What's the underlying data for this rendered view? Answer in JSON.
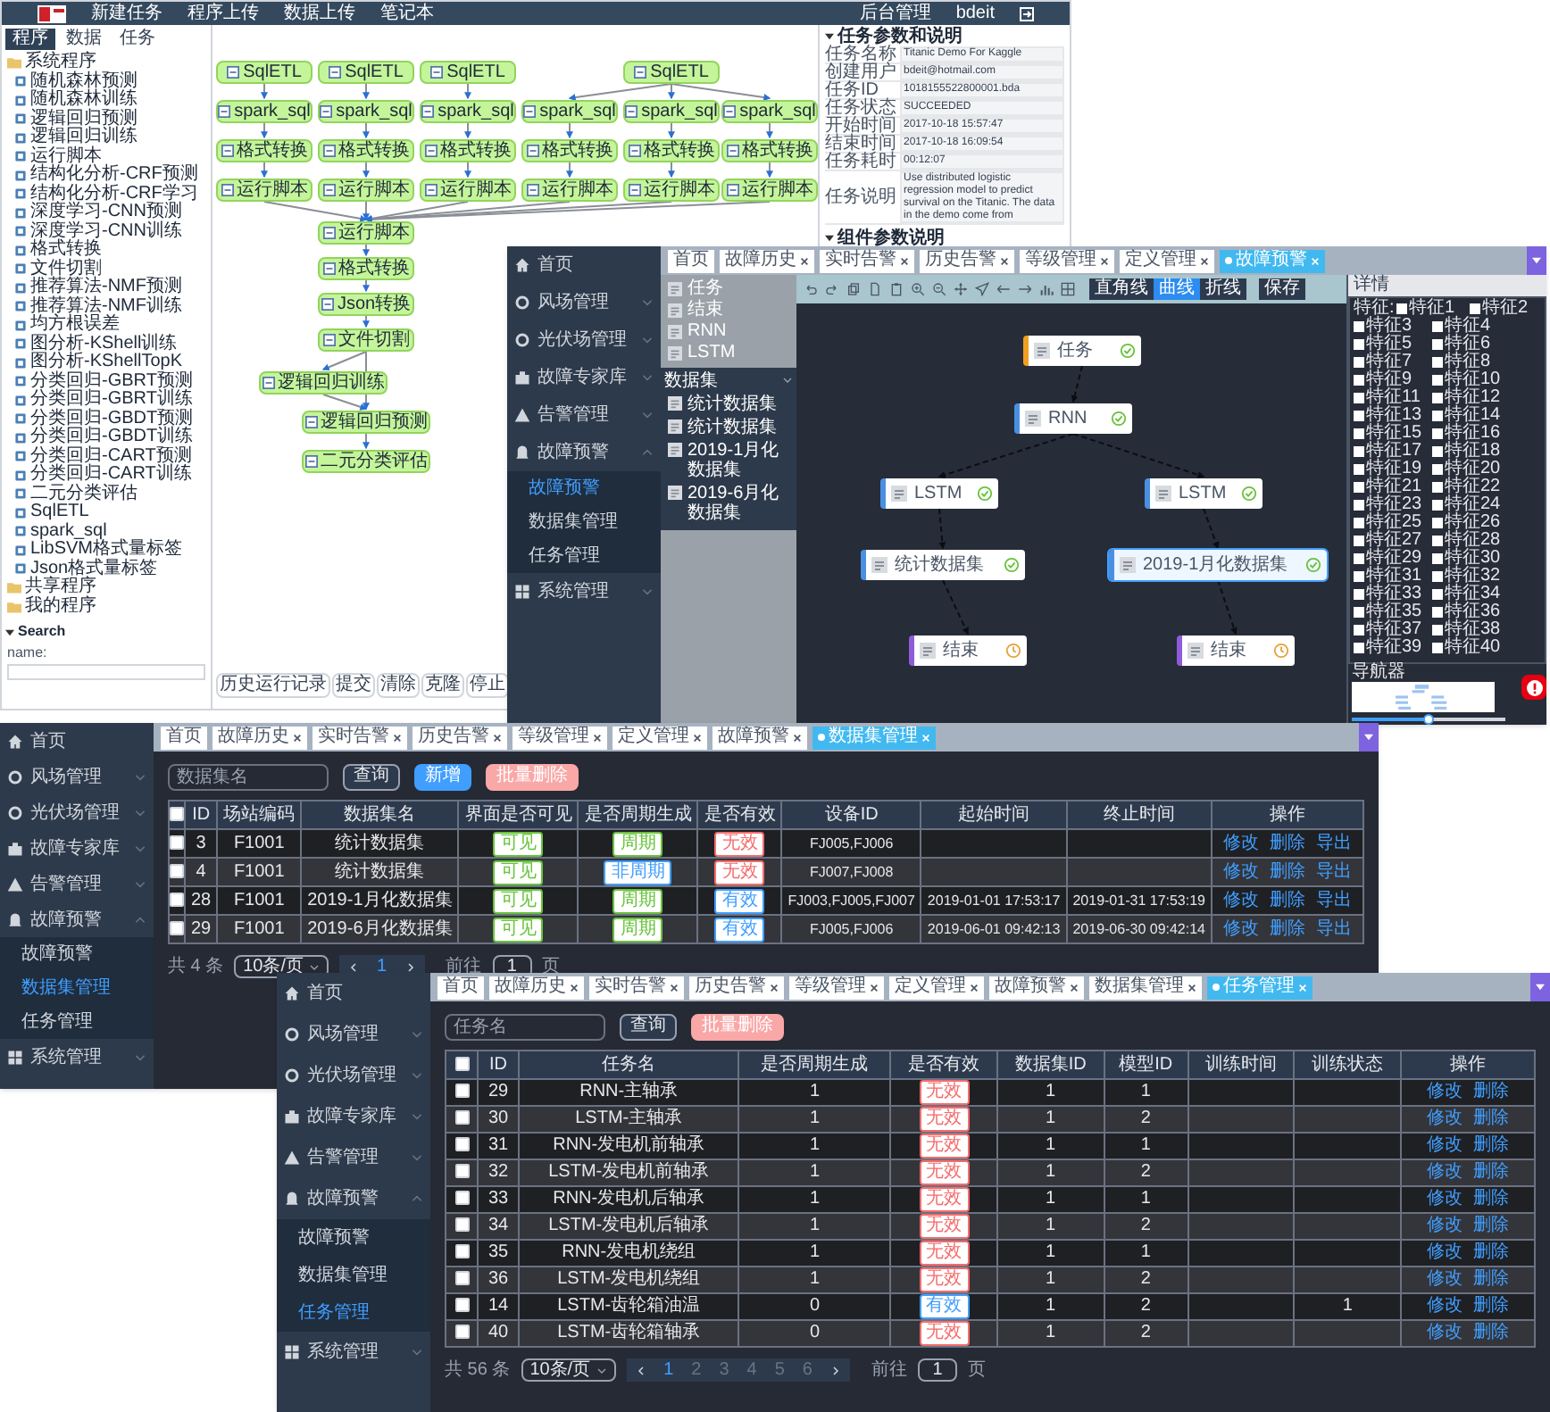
{
  "workflow_app": {
    "nav": [
      "新建任务",
      "程序上传",
      "数据上传",
      "笔记本"
    ],
    "user_links": [
      "后台管理",
      "bdeit"
    ],
    "sidebar_tabs": [
      {
        "label": "程序",
        "selected": true
      },
      {
        "label": "数据",
        "selected": false
      },
      {
        "label": "任务",
        "selected": false
      }
    ],
    "tree": [
      {
        "label": "系统程序",
        "children": [
          "随机森林预测",
          "随机森林训练",
          "逻辑回归预测",
          "逻辑回归训练",
          "运行脚本",
          "结构化分析-CRF预测",
          "结构化分析-CRF学习",
          "深度学习-CNN预测",
          "深度学习-CNN训练",
          "格式转换",
          "文件切割",
          "推荐算法-NMF预测",
          "推荐算法-NMF训练",
          "均方根误差",
          "图分析-KShell训练",
          "图分析-KShellTopK",
          "分类回归-GBRT预测",
          "分类回归-GBRT训练",
          "分类回归-GBDT预测",
          "分类回归-GBDT训练",
          "分类回归-CART预测",
          "分类回归-CART训练",
          "二元分类评估",
          "SqlETL",
          "spark_sql",
          "LibSVM格式量标签",
          "Json格式量标签"
        ]
      },
      {
        "label": "共享程序"
      },
      {
        "label": "我的程序"
      }
    ],
    "search": {
      "title": "Search",
      "field_label": "name:"
    },
    "graph_nodes": [
      "SqlETL",
      "SqlETL",
      "SqlETL",
      "SqlETL",
      "spark_sql",
      "spark_sql",
      "spark_sql",
      "spark_sql",
      "spark_sql",
      "spark_sql",
      "格式转换",
      "格式转换",
      "格式转换",
      "格式转换",
      "格式转换",
      "格式转换",
      "运行脚本",
      "运行脚本",
      "运行脚本",
      "运行脚本",
      "运行脚本",
      "运行脚本",
      "运行脚本",
      "格式转换",
      "Json转换",
      "文件切割",
      "逻辑回归训练",
      "逻辑回归预测",
      "二元分类评估"
    ],
    "buttons": [
      "历史运行记录",
      "提交",
      "清除",
      "克隆",
      "停止"
    ],
    "task_params": {
      "title": "任务参数和说明",
      "rows": [
        {
          "label": "任务名称",
          "value": "Titanic Demo For Kaggle"
        },
        {
          "label": "创建用户",
          "value": "bdeit@hotmail.com"
        },
        {
          "label": "任务ID",
          "value": "1018155522800001.bda"
        },
        {
          "label": "任务状态",
          "value": "SUCCEEDED"
        },
        {
          "label": "开始时间",
          "value": "2017-10-18 15:57:47"
        },
        {
          "label": "结束时间",
          "value": "2017-10-18 16:09:54"
        },
        {
          "label": "任务耗时",
          "value": "00:12:07"
        },
        {
          "label": "任务说明",
          "value": "Use distributed logistic regression model to predict survival on the Titanic. The data in the demo come from"
        }
      ]
    },
    "component_params": {
      "title": "组件参数说明"
    }
  },
  "fault_flow_app": {
    "menu": [
      {
        "label": "首页"
      },
      {
        "label": "风场管理",
        "expanded": false
      },
      {
        "label": "光伏场管理",
        "expanded": false
      },
      {
        "label": "故障专家库",
        "expanded": false
      },
      {
        "label": "告警管理",
        "expanded": false
      },
      {
        "label": "故障预警",
        "expanded": true,
        "children": [
          {
            "label": "故障预警",
            "selected": true
          },
          {
            "label": "数据集管理",
            "selected": false
          },
          {
            "label": "任务管理",
            "selected": false
          }
        ]
      },
      {
        "label": "系统管理",
        "expanded": false
      }
    ],
    "tabs": [
      {
        "label": "首页",
        "closable": false,
        "selected": false
      },
      {
        "label": "故障历史",
        "closable": true,
        "selected": false
      },
      {
        "label": "实时告警",
        "closable": true,
        "selected": false
      },
      {
        "label": "历史告警",
        "closable": true,
        "selected": false
      },
      {
        "label": "等级管理",
        "closable": true,
        "selected": false
      },
      {
        "label": "定义管理",
        "closable": true,
        "selected": false
      },
      {
        "label": "故障预警",
        "closable": true,
        "selected": true
      }
    ],
    "palette": {
      "nodes": [
        "任务",
        "结束",
        "RNN",
        "LSTM"
      ],
      "dataset_title": "数据集",
      "datasets": [
        "统计数据集",
        "统计数据集",
        "2019-1月化数据集",
        "2019-6月化数据集"
      ]
    },
    "line_styles": [
      {
        "label": "直角线",
        "selected": false
      },
      {
        "label": "曲线",
        "selected": true
      },
      {
        "label": "折线",
        "selected": false
      }
    ],
    "save_button": "保存",
    "flow_nodes": [
      {
        "label": "任务",
        "color": "#f0a020",
        "done": true,
        "selected": false
      },
      {
        "label": "RNN",
        "color": "#4a90e2",
        "done": true,
        "selected": false
      },
      {
        "label": "LSTM",
        "color": "#4a90e2",
        "done": true,
        "selected": false
      },
      {
        "label": "LSTM",
        "color": "#4a90e2",
        "done": true,
        "selected": false
      },
      {
        "label": "统计数据集",
        "color": "#4a90e2",
        "done": true,
        "selected": false
      },
      {
        "label": "2019-1月化数据集",
        "color": "#4a90e2",
        "done": true,
        "selected": true
      },
      {
        "label": "结束",
        "color": "#8e5cd9",
        "done": false,
        "selected": false
      },
      {
        "label": "结束",
        "color": "#8e5cd9",
        "done": false,
        "selected": false
      }
    ],
    "details": {
      "title": "详情",
      "feature_label": "特征:",
      "features": [
        {
          "label": "特征1",
          "checked": false
        },
        {
          "label": "特征2",
          "checked": false
        },
        {
          "label": "特征3",
          "checked": false
        },
        {
          "label": "特征4",
          "checked": false
        },
        {
          "label": "特征5",
          "checked": false
        },
        {
          "label": "特征6",
          "checked": false
        },
        {
          "label": "特征7",
          "checked": false
        },
        {
          "label": "特征8",
          "checked": false
        },
        {
          "label": "特征9",
          "checked": false
        },
        {
          "label": "特征10",
          "checked": false
        },
        {
          "label": "特征11",
          "checked": false
        },
        {
          "label": "特征12",
          "checked": false
        },
        {
          "label": "特征13",
          "checked": false
        },
        {
          "label": "特征14",
          "checked": false
        },
        {
          "label": "特征15",
          "checked": false
        },
        {
          "label": "特征16",
          "checked": false
        },
        {
          "label": "特征17",
          "checked": false
        },
        {
          "label": "特征18",
          "checked": false
        },
        {
          "label": "特征19",
          "checked": false
        },
        {
          "label": "特征20",
          "checked": false
        },
        {
          "label": "特征21",
          "checked": false
        },
        {
          "label": "特征22",
          "checked": false
        },
        {
          "label": "特征23",
          "checked": false
        },
        {
          "label": "特征24",
          "checked": false
        },
        {
          "label": "特征25",
          "checked": false
        },
        {
          "label": "特征26",
          "checked": false
        },
        {
          "label": "特征27",
          "checked": false
        },
        {
          "label": "特征28",
          "checked": false
        },
        {
          "label": "特征29",
          "checked": false
        },
        {
          "label": "特征30",
          "checked": false
        },
        {
          "label": "特征31",
          "checked": false
        },
        {
          "label": "特征32",
          "checked": false
        },
        {
          "label": "特征33",
          "checked": false
        },
        {
          "label": "特征34",
          "checked": false
        },
        {
          "label": "特征35",
          "checked": false
        },
        {
          "label": "特征36",
          "checked": false
        },
        {
          "label": "特征37",
          "checked": false
        },
        {
          "label": "特征38",
          "checked": false
        },
        {
          "label": "特征39",
          "checked": false
        },
        {
          "label": "特征40",
          "checked": false
        }
      ]
    },
    "navigator": {
      "title": "导航器",
      "zoom": {
        "level": 0.5
      }
    }
  },
  "dataset_app": {
    "menu": [
      {
        "label": "首页"
      },
      {
        "label": "风场管理",
        "expanded": false
      },
      {
        "label": "光伏场管理",
        "expanded": false
      },
      {
        "label": "故障专家库",
        "expanded": false
      },
      {
        "label": "告警管理",
        "expanded": false
      },
      {
        "label": "故障预警",
        "expanded": true,
        "children": [
          {
            "label": "故障预警",
            "selected": false
          },
          {
            "label": "数据集管理",
            "selected": true
          },
          {
            "label": "任务管理",
            "selected": false
          }
        ]
      },
      {
        "label": "系统管理",
        "expanded": false
      }
    ],
    "tabs": [
      {
        "label": "首页",
        "closable": false,
        "selected": false
      },
      {
        "label": "故障历史",
        "closable": true,
        "selected": false
      },
      {
        "label": "实时告警",
        "closable": true,
        "selected": false
      },
      {
        "label": "历史告警",
        "closable": true,
        "selected": false
      },
      {
        "label": "等级管理",
        "closable": true,
        "selected": false
      },
      {
        "label": "定义管理",
        "closable": true,
        "selected": false
      },
      {
        "label": "故障预警",
        "closable": true,
        "selected": false
      },
      {
        "label": "数据集管理",
        "closable": true,
        "selected": true
      }
    ],
    "search": {
      "placeholder": "数据集名"
    },
    "buttons": [
      {
        "label": "查询",
        "kind": "outline"
      },
      {
        "label": "新增",
        "kind": "primary"
      },
      {
        "label": "批量删除",
        "kind": "danger"
      }
    ],
    "table": {
      "header_checked": false,
      "columns": [
        "ID",
        "场站编码",
        "数据集名",
        "界面是否可见",
        "是否周期生成",
        "是否有效",
        "设备ID",
        "起始时间",
        "终止时间",
        "操作"
      ],
      "rows": [
        {
          "checked": false,
          "id": "3",
          "station": "F1001",
          "name": "统计数据集",
          "visible": {
            "text": "可见",
            "color": "#67c23a"
          },
          "periodic": {
            "text": "周期",
            "color": "#67c23a"
          },
          "valid": {
            "text": "无效",
            "color": "#f56c6c"
          },
          "devices": "FJ005,FJ006",
          "actions": [
            "修改",
            "删除",
            "导出"
          ]
        },
        {
          "checked": false,
          "id": "4",
          "station": "F1001",
          "name": "统计数据集",
          "visible": {
            "text": "可见",
            "color": "#67c23a"
          },
          "periodic": {
            "text": "非周期",
            "color": "#409eff"
          },
          "valid": {
            "text": "无效",
            "color": "#f56c6c"
          },
          "devices": "FJ007,FJ008",
          "actions": [
            "修改",
            "删除",
            "导出"
          ]
        },
        {
          "checked": false,
          "id": "28",
          "station": "F1001",
          "name": "2019-1月化数据集",
          "visible": {
            "text": "可见",
            "color": "#67c23a"
          },
          "periodic": {
            "text": "周期",
            "color": "#67c23a"
          },
          "valid": {
            "text": "有效",
            "color": "#409eff"
          },
          "devices": "FJ003,FJ005,FJ007",
          "start": "2019-01-01 17:53:17",
          "end": "2019-01-31 17:53:19",
          "actions": [
            "修改",
            "删除",
            "导出"
          ]
        },
        {
          "checked": false,
          "id": "29",
          "station": "F1001",
          "name": "2019-6月化数据集",
          "visible": {
            "text": "可见",
            "color": "#67c23a"
          },
          "periodic": {
            "text": "周期",
            "color": "#67c23a"
          },
          "valid": {
            "text": "有效",
            "color": "#409eff"
          },
          "devices": "FJ005,FJ006",
          "start": "2019-06-01 09:42:13",
          "end": "2019-06-30 09:42:14",
          "actions": [
            "修改",
            "删除",
            "导出"
          ]
        }
      ]
    },
    "pagination": {
      "total": "共 4 条",
      "page_size": "10条/页",
      "pages": [
        {
          "label": "1",
          "selected": true
        }
      ],
      "goto_label": "前往",
      "goto_value": "1",
      "page_suffix": "页"
    }
  },
  "task_app": {
    "menu": [
      {
        "label": "首页"
      },
      {
        "label": "风场管理",
        "expanded": false
      },
      {
        "label": "光伏场管理",
        "expanded": false
      },
      {
        "label": "故障专家库",
        "expanded": false
      },
      {
        "label": "告警管理",
        "expanded": false
      },
      {
        "label": "故障预警",
        "expanded": true,
        "children": [
          {
            "label": "故障预警",
            "selected": false
          },
          {
            "label": "数据集管理",
            "selected": false
          },
          {
            "label": "任务管理",
            "selected": true
          }
        ]
      },
      {
        "label": "系统管理",
        "expanded": false
      }
    ],
    "tabs": [
      {
        "label": "首页",
        "closable": false,
        "selected": false
      },
      {
        "label": "故障历史",
        "closable": true,
        "selected": false
      },
      {
        "label": "实时告警",
        "closable": true,
        "selected": false
      },
      {
        "label": "历史告警",
        "closable": true,
        "selected": false
      },
      {
        "label": "等级管理",
        "closable": true,
        "selected": false
      },
      {
        "label": "定义管理",
        "closable": true,
        "selected": false
      },
      {
        "label": "故障预警",
        "closable": true,
        "selected": false
      },
      {
        "label": "数据集管理",
        "closable": true,
        "selected": false
      },
      {
        "label": "任务管理",
        "closable": true,
        "selected": true
      }
    ],
    "search": {
      "placeholder": "任务名"
    },
    "buttons": [
      {
        "label": "查询",
        "kind": "outline"
      },
      {
        "label": "批量删除",
        "kind": "danger"
      }
    ],
    "table": {
      "header_checked": false,
      "columns": [
        "ID",
        "任务名",
        "是否周期生成",
        "是否有效",
        "数据集ID",
        "模型ID",
        "训练时间",
        "训练状态",
        "操作"
      ],
      "rows": [
        {
          "checked": false,
          "id": "29",
          "name": "RNN-主轴承",
          "periodic": "1",
          "valid": {
            "text": "无效",
            "color": "#f56c6c"
          },
          "dataset_id": "1",
          "model_id": "1",
          "actions": [
            "修改",
            "删除"
          ]
        },
        {
          "checked": false,
          "id": "30",
          "name": "LSTM-主轴承",
          "periodic": "1",
          "valid": {
            "text": "无效",
            "color": "#f56c6c"
          },
          "dataset_id": "1",
          "model_id": "2",
          "actions": [
            "修改",
            "删除"
          ]
        },
        {
          "checked": false,
          "id": "31",
          "name": "RNN-发电机前轴承",
          "periodic": "1",
          "valid": {
            "text": "无效",
            "color": "#f56c6c"
          },
          "dataset_id": "1",
          "model_id": "1",
          "actions": [
            "修改",
            "删除"
          ]
        },
        {
          "checked": false,
          "id": "32",
          "name": "LSTM-发电机前轴承",
          "periodic": "1",
          "valid": {
            "text": "无效",
            "color": "#f56c6c"
          },
          "dataset_id": "1",
          "model_id": "2",
          "actions": [
            "修改",
            "删除"
          ]
        },
        {
          "checked": false,
          "id": "33",
          "name": "RNN-发电机后轴承",
          "periodic": "1",
          "valid": {
            "text": "无效",
            "color": "#f56c6c"
          },
          "dataset_id": "1",
          "model_id": "1",
          "actions": [
            "修改",
            "删除"
          ]
        },
        {
          "checked": false,
          "id": "34",
          "name": "LSTM-发电机后轴承",
          "periodic": "1",
          "valid": {
            "text": "无效",
            "color": "#f56c6c"
          },
          "dataset_id": "1",
          "model_id": "2",
          "actions": [
            "修改",
            "删除"
          ]
        },
        {
          "checked": false,
          "id": "35",
          "name": "RNN-发电机绕组",
          "periodic": "1",
          "valid": {
            "text": "无效",
            "color": "#f56c6c"
          },
          "dataset_id": "1",
          "model_id": "1",
          "actions": [
            "修改",
            "删除"
          ]
        },
        {
          "checked": false,
          "id": "36",
          "name": "LSTM-发电机绕组",
          "periodic": "1",
          "valid": {
            "text": "无效",
            "color": "#f56c6c"
          },
          "dataset_id": "1",
          "model_id": "2",
          "actions": [
            "修改",
            "删除"
          ]
        },
        {
          "checked": false,
          "id": "14",
          "name": "LSTM-齿轮箱油温",
          "periodic": "0",
          "valid": {
            "text": "有效",
            "color": "#409eff"
          },
          "dataset_id": "1",
          "model_id": "2",
          "train_status": "1",
          "actions": [
            "修改",
            "删除"
          ]
        },
        {
          "checked": false,
          "id": "40",
          "name": "LSTM-齿轮箱轴承",
          "periodic": "0",
          "valid": {
            "text": "无效",
            "color": "#f56c6c"
          },
          "dataset_id": "1",
          "model_id": "2",
          "actions": [
            "修改",
            "删除"
          ]
        }
      ]
    },
    "pagination": {
      "total": "共 56 条",
      "page_size": "10条/页",
      "pages": [
        {
          "label": "1",
          "selected": true
        },
        {
          "label": "2",
          "selected": false
        },
        {
          "label": "3",
          "selected": false
        },
        {
          "label": "4",
          "selected": false
        },
        {
          "label": "5",
          "selected": false
        },
        {
          "label": "6",
          "selected": false
        }
      ],
      "goto_label": "前往",
      "goto_value": "1",
      "page_suffix": "页"
    }
  }
}
